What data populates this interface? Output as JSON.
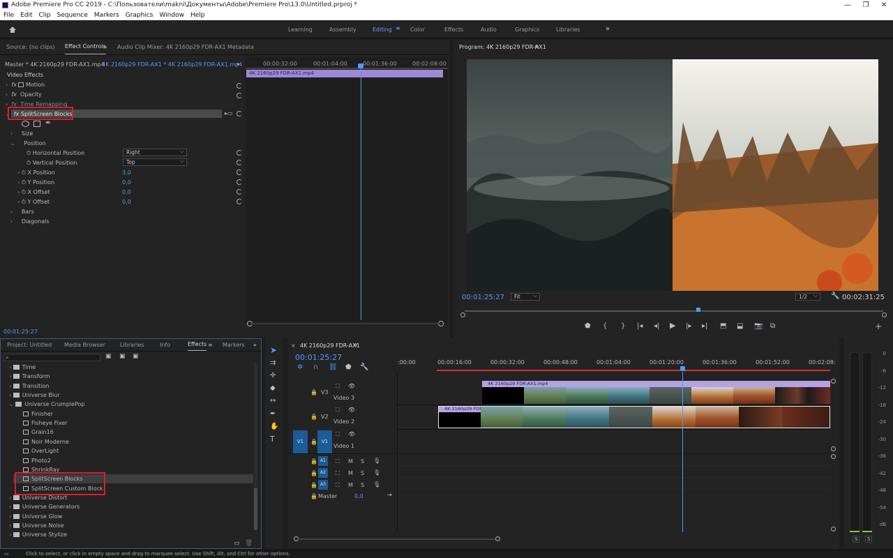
{
  "titlebar": {
    "title": "Adobe Premiere Pro CC 2019 - C:\\Пользователи\\makni\\Документы\\Adobe\\Premiere Pro\\13.0\\Untitled.prproj *",
    "min": "—",
    "max": "❐",
    "close": "✕"
  },
  "menu": [
    "File",
    "Edit",
    "Clip",
    "Sequence",
    "Markers",
    "Graphics",
    "Window",
    "Help"
  ],
  "workspaces": [
    "Learning",
    "Assembly",
    "Editing",
    "Color",
    "Effects",
    "Audio",
    "Graphics",
    "Libraries"
  ],
  "workspace_more": "»",
  "source_panel": {
    "tabs": [
      "Source: (no clips)",
      "Effect Controls",
      "Audio Clip Mixer: 4K 2160p29 FDR-AX1",
      "Metadata"
    ],
    "master": "Master * 4K 2160p29 FDR-AX1.mp4",
    "seq": "4K 2160p29 FDR-AX1 * 4K 2160p29 FDR-AX1.mp4",
    "ruler": [
      "00:00:32:00",
      "00:01:04:00",
      "00:01:36:00",
      "00:02:08:00"
    ],
    "clip_label": "4K 2160p29 FDR-AX1.mp4",
    "section": "Video Effects",
    "effects": [
      "Motion",
      "Opacity",
      "Time Remapping",
      "SplitScreen Blocks"
    ],
    "props": {
      "size": "Size",
      "position": "Position",
      "hpos": "Horizontal Position",
      "hpos_val": "Right",
      "vpos": "Vertical Position",
      "vpos_val": "Top",
      "xpos": "X Position",
      "xpos_val": "3,0",
      "ypos": "Y Position",
      "ypos_val": "0,0",
      "xoff": "X Offset",
      "xoff_val": "0,0",
      "yoff": "Y Offset",
      "yoff_val": "0,0",
      "bars": "Bars",
      "diag": "Diagonals"
    },
    "timecode": "00:01:25:27"
  },
  "program": {
    "title": "Program: 4K 2160p29 FDR-AX1",
    "timecode": "00:01:25:27",
    "fit": "Fit",
    "res": "1/2",
    "duration": "00:02:31:25"
  },
  "project_panel": {
    "tabs": [
      "Project: Untitled",
      "Media Browser",
      "Libraries",
      "Info",
      "Effects",
      "Markers"
    ],
    "items": [
      {
        "t": "Time",
        "kind": "folder",
        "lvl": 0
      },
      {
        "t": "Transform",
        "kind": "folder",
        "lvl": 0
      },
      {
        "t": "Transition",
        "kind": "folder",
        "lvl": 0
      },
      {
        "t": "Universe Blur",
        "kind": "folder",
        "lvl": 0
      },
      {
        "t": "Universe CrumplePop",
        "kind": "folder",
        "lvl": 0,
        "open": true
      },
      {
        "t": "Finisher",
        "kind": "fx",
        "lvl": 1
      },
      {
        "t": "Fisheye Fixer",
        "kind": "fx",
        "lvl": 1
      },
      {
        "t": "Grain16",
        "kind": "fx",
        "lvl": 1
      },
      {
        "t": "Noir Moderne",
        "kind": "fx",
        "lvl": 1
      },
      {
        "t": "OverLight",
        "kind": "fx",
        "lvl": 1
      },
      {
        "t": "Photo2",
        "kind": "fx",
        "lvl": 1
      },
      {
        "t": "ShrinkRay",
        "kind": "fx",
        "lvl": 1
      },
      {
        "t": "SplitScreen Blocks",
        "kind": "fx",
        "lvl": 1,
        "sel": true
      },
      {
        "t": "SplitScreen Custom Block",
        "kind": "fx",
        "lvl": 1
      },
      {
        "t": "Universe Distort",
        "kind": "folder",
        "lvl": 0
      },
      {
        "t": "Universe Generators",
        "kind": "folder",
        "lvl": 0
      },
      {
        "t": "Universe Glow",
        "kind": "folder",
        "lvl": 0
      },
      {
        "t": "Universe Noise",
        "kind": "folder",
        "lvl": 0
      },
      {
        "t": "Universe Stylize",
        "kind": "folder",
        "lvl": 0
      }
    ]
  },
  "timeline": {
    "tab": "4K 2160p29 FDR-AX1",
    "timecode": "00:01:25:27",
    "ruler": [
      ":00:00",
      "00:00:16:00",
      "00:00:32:00",
      "00:00:48:00",
      "00:01:04:00",
      "00:01:20:00",
      "00:01:36:00",
      "00:01:52:00",
      "00:02:08:"
    ],
    "tracks": {
      "v3": "V3",
      "v2": "V2",
      "v1": "V1",
      "video3": "Video 3",
      "video2": "Video 2",
      "video1": "Video 1",
      "a1": "A1",
      "a2": "A2",
      "a3": "A3",
      "m": "M",
      "s": "S",
      "master": "Master",
      "master_val": "0,0"
    },
    "clip_v3": "4K 2160p29 FDR-AX1.mp4",
    "clip_v2": "4K 2160p29 FDR-AX1.mp4"
  },
  "meter": {
    "labels": [
      "0",
      "-6",
      "-12",
      "-18",
      "-24",
      "-30",
      "-36",
      "-42",
      "-48",
      "-54",
      "dB"
    ],
    "s": "S"
  },
  "status": "Click to select, or click in empty space and drag to marquee select. Use Shift, Alt, and Ctrl for other options."
}
